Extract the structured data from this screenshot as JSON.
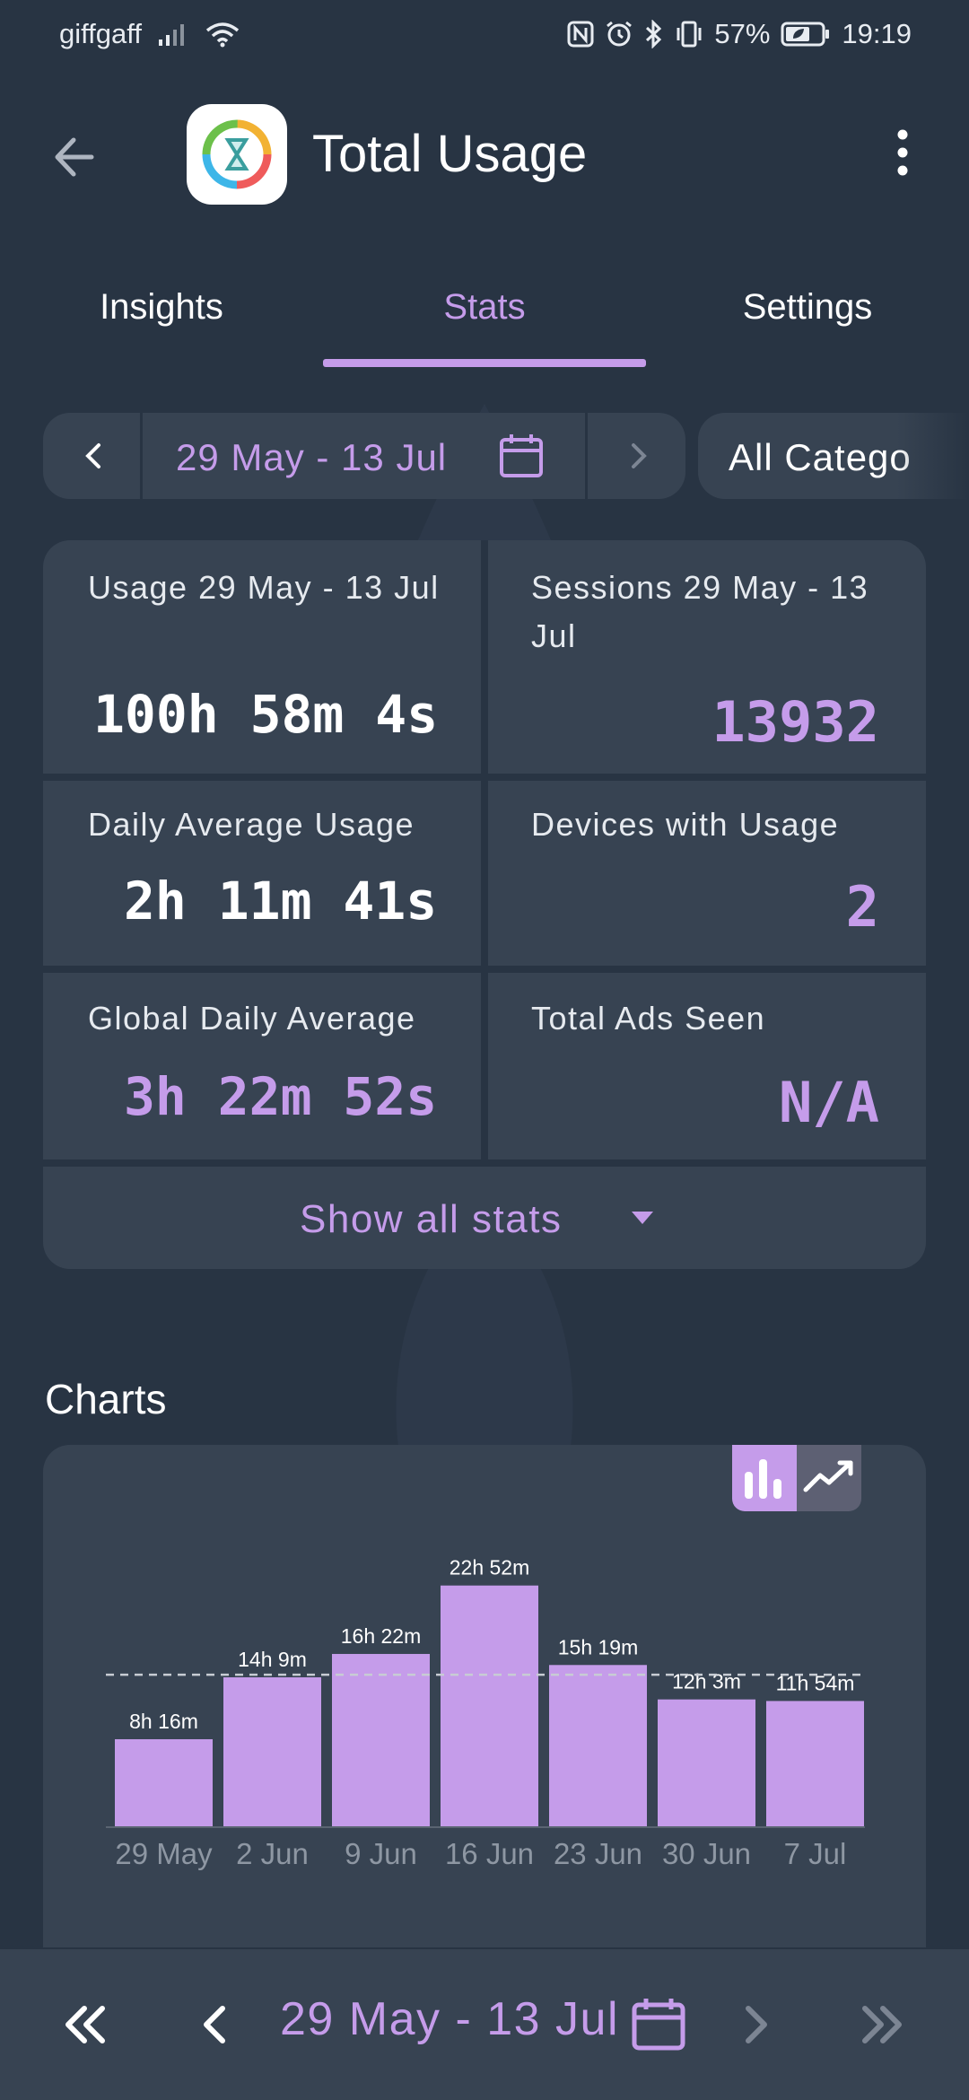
{
  "status_bar": {
    "carrier": "giffgaff",
    "battery": "57%",
    "time": "19:19"
  },
  "app_bar": {
    "title": "Total Usage"
  },
  "tabs": [
    {
      "label": "Insights",
      "active": false
    },
    {
      "label": "Stats",
      "active": true
    },
    {
      "label": "Settings",
      "active": false
    }
  ],
  "range": {
    "label": "29 May - 13 Jul",
    "category": "All Catego"
  },
  "stats": {
    "usage_label": "Usage 29 May - 13 Jul",
    "usage_value": "100h 58m 4s",
    "sessions_label": "Sessions 29 May - 13 Jul",
    "sessions_value": "13932",
    "daily_avg_label": "Daily Average Usage",
    "daily_avg_value": "2h 11m 41s",
    "devices_label": "Devices with Usage",
    "devices_value": "2",
    "global_avg_label": "Global Daily Average",
    "global_avg_value": "3h 22m 52s",
    "ads_label": "Total Ads Seen",
    "ads_value": "N/A",
    "show_all_label": "Show all stats"
  },
  "charts_title": "Charts",
  "chart_data": {
    "type": "bar",
    "categories": [
      "29 May",
      "2 Jun",
      "9 Jun",
      "16 Jun",
      "23 Jun",
      "30 Jun",
      "7 Jul"
    ],
    "values": [
      8.27,
      14.15,
      16.37,
      22.87,
      15.32,
      12.05,
      11.9
    ],
    "data_labels": [
      "8h 16m",
      "14h 9m",
      "16h 22m",
      "22h 52m",
      "15h 19m",
      "12h 3m",
      "11h 54m"
    ],
    "ylim": [
      0,
      26
    ],
    "average_line": 14.4,
    "color": "#c59cea"
  },
  "bottom_bar": {
    "label": "29 May - 13 Jul"
  },
  "colors": {
    "background": "#283443",
    "card": "#374352",
    "accent": "#c59cea"
  }
}
